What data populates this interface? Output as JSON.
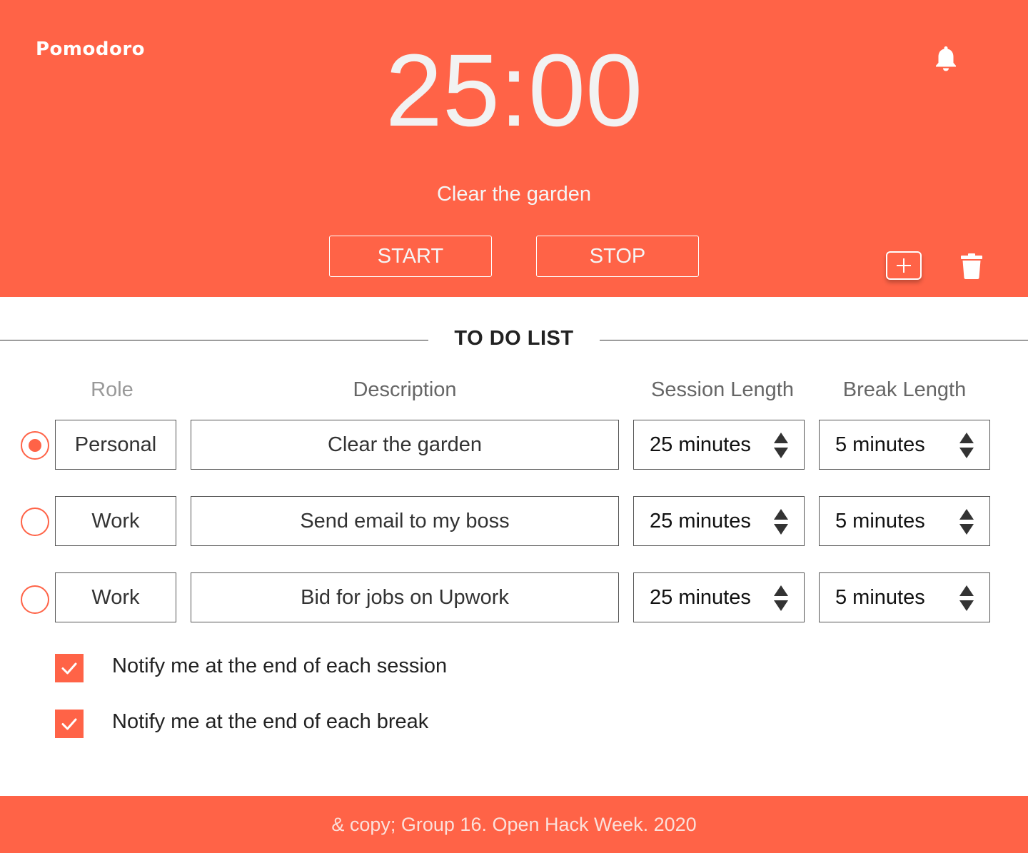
{
  "header": {
    "brand": "Pomodoro",
    "timer": "25:00",
    "current_task": "Clear the garden",
    "start_label": "START",
    "stop_label": "STOP",
    "icons": [
      "bell-icon",
      "plus-icon",
      "trash-icon"
    ]
  },
  "todo": {
    "title": "TO DO LIST",
    "columns": {
      "role": "Role",
      "description": "Description",
      "session": "Session Length",
      "break": "Break Length"
    },
    "rows": [
      {
        "selected": true,
        "role": "Personal",
        "description": "Clear the garden",
        "session": "25 minutes",
        "break": "5 minutes"
      },
      {
        "selected": false,
        "role": "Work",
        "description": "Send email to my boss",
        "session": "25 minutes",
        "break": "5 minutes"
      },
      {
        "selected": false,
        "role": "Work",
        "description": "Bid for jobs on Upwork",
        "session": "25 minutes",
        "break": "5 minutes"
      }
    ]
  },
  "notifications": [
    {
      "checked": true,
      "label": "Notify me at the end of each session"
    },
    {
      "checked": true,
      "label": "Notify me at the end of each break"
    }
  ],
  "footer": {
    "text": "& copy; Group 16. Open Hack Week. 2020"
  },
  "colors": {
    "accent": "#ff6347",
    "text": "#333333",
    "muted": "#999999"
  }
}
